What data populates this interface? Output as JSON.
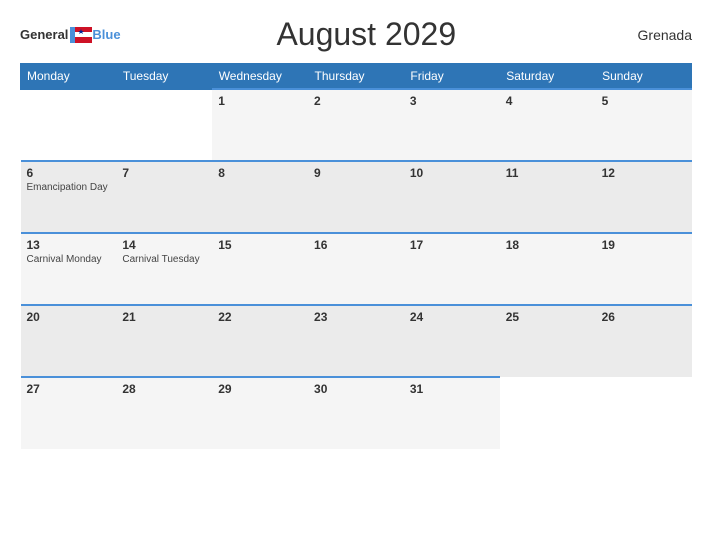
{
  "header": {
    "logo_general": "General",
    "logo_blue": "Blue",
    "title": "August 2029",
    "country": "Grenada"
  },
  "calendar": {
    "weekdays": [
      "Monday",
      "Tuesday",
      "Wednesday",
      "Thursday",
      "Friday",
      "Saturday",
      "Sunday"
    ],
    "weeks": [
      [
        {
          "day": "",
          "event": ""
        },
        {
          "day": "",
          "event": ""
        },
        {
          "day": "1",
          "event": ""
        },
        {
          "day": "2",
          "event": ""
        },
        {
          "day": "3",
          "event": ""
        },
        {
          "day": "4",
          "event": ""
        },
        {
          "day": "5",
          "event": ""
        }
      ],
      [
        {
          "day": "6",
          "event": "Emancipation Day"
        },
        {
          "day": "7",
          "event": ""
        },
        {
          "day": "8",
          "event": ""
        },
        {
          "day": "9",
          "event": ""
        },
        {
          "day": "10",
          "event": ""
        },
        {
          "day": "11",
          "event": ""
        },
        {
          "day": "12",
          "event": ""
        }
      ],
      [
        {
          "day": "13",
          "event": "Carnival Monday"
        },
        {
          "day": "14",
          "event": "Carnival Tuesday"
        },
        {
          "day": "15",
          "event": ""
        },
        {
          "day": "16",
          "event": ""
        },
        {
          "day": "17",
          "event": ""
        },
        {
          "day": "18",
          "event": ""
        },
        {
          "day": "19",
          "event": ""
        }
      ],
      [
        {
          "day": "20",
          "event": ""
        },
        {
          "day": "21",
          "event": ""
        },
        {
          "day": "22",
          "event": ""
        },
        {
          "day": "23",
          "event": ""
        },
        {
          "day": "24",
          "event": ""
        },
        {
          "day": "25",
          "event": ""
        },
        {
          "day": "26",
          "event": ""
        }
      ],
      [
        {
          "day": "27",
          "event": ""
        },
        {
          "day": "28",
          "event": ""
        },
        {
          "day": "29",
          "event": ""
        },
        {
          "day": "30",
          "event": ""
        },
        {
          "day": "31",
          "event": ""
        },
        {
          "day": "",
          "event": ""
        },
        {
          "day": "",
          "event": ""
        }
      ]
    ]
  }
}
